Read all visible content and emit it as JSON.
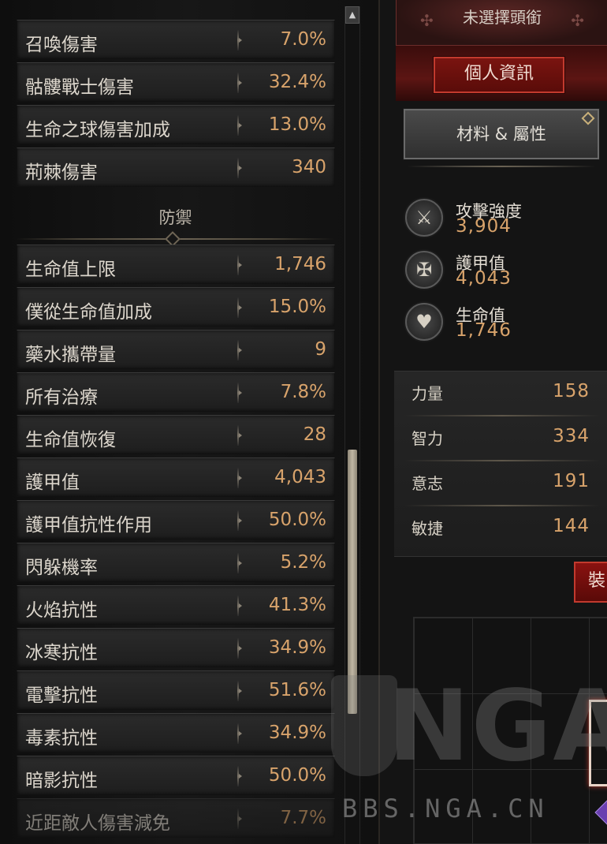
{
  "stats_top": [
    {
      "label": "召喚傷害",
      "value": "7.0%"
    },
    {
      "label": "骷髏戰士傷害",
      "value": "32.4%"
    },
    {
      "label": "生命之球傷害加成",
      "value": "13.0%"
    },
    {
      "label": "荊棘傷害",
      "value": "340"
    }
  ],
  "defense_section": {
    "title": "防禦",
    "stats": [
      {
        "label": "生命值上限",
        "value": "1,746"
      },
      {
        "label": "僕從生命值加成",
        "value": "15.0%"
      },
      {
        "label": "藥水攜帶量",
        "value": "9"
      },
      {
        "label": "所有治療",
        "value": "7.8%"
      },
      {
        "label": "生命值恢復",
        "value": "28"
      },
      {
        "label": "護甲值",
        "value": "4,043"
      },
      {
        "label": "護甲值抗性作用",
        "value": "50.0%"
      },
      {
        "label": "閃躲機率",
        "value": "5.2%"
      },
      {
        "label": "火焰抗性",
        "value": "41.3%"
      },
      {
        "label": "冰寒抗性",
        "value": "34.9%"
      },
      {
        "label": "電擊抗性",
        "value": "51.6%"
      },
      {
        "label": "毒素抗性",
        "value": "34.9%"
      },
      {
        "label": "暗影抗性",
        "value": "50.0%"
      },
      {
        "label": "近距敵人傷害減免",
        "value": "7.7%"
      }
    ]
  },
  "scrollbar": {
    "up_arrow": "▲"
  },
  "right_panel": {
    "title_label": "未選擇頭銜",
    "profile_button": "個人資訊",
    "materials_button": "材料 & 屬性",
    "core_stats": [
      {
        "label": "攻擊強度",
        "value": "3,904",
        "icon": "crossed-swords-icon",
        "glyph": "⚔"
      },
      {
        "label": "護甲值",
        "value": "4,043",
        "icon": "shield-icon",
        "glyph": "✠"
      },
      {
        "label": "生命值",
        "value": "1,746",
        "icon": "heart-icon",
        "glyph": "♥"
      }
    ],
    "attributes": [
      {
        "label": "力量",
        "value": "158"
      },
      {
        "label": "智力",
        "value": "334"
      },
      {
        "label": "意志",
        "value": "191"
      },
      {
        "label": "敏捷",
        "value": "144"
      }
    ],
    "equipment_tab": "裝"
  },
  "watermark": {
    "logo_text": "NGA",
    "url": "BBS.NGA.CN"
  },
  "colors": {
    "value_gold": "#d8a36b",
    "accent_red": "#c23a2e"
  }
}
